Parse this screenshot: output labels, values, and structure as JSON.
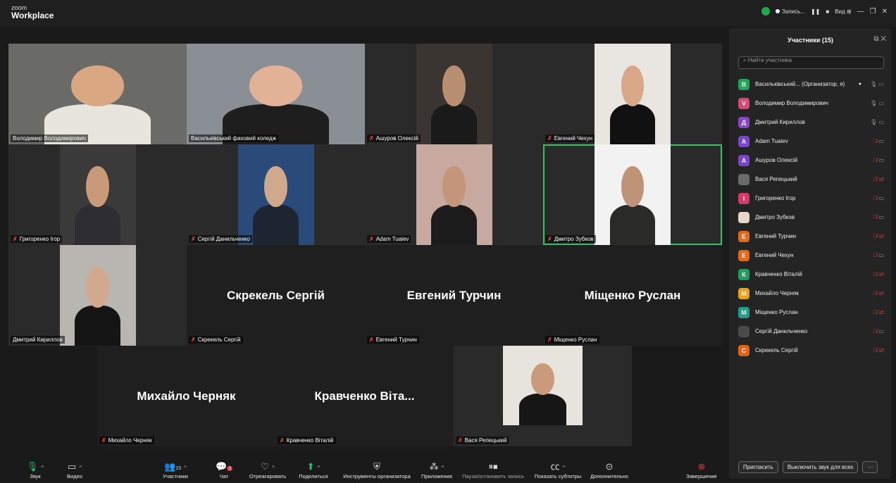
{
  "app": {
    "brand_small": "zoom",
    "brand": "Workplace"
  },
  "titlebar": {
    "recording": "Запись...",
    "view": "Вид"
  },
  "tiles": [
    {
      "name": "Володимир Володимирович",
      "muted": false,
      "video": true,
      "skin": "#d9a882",
      "shirt": "#e8e4de",
      "bg": "#6a6a66"
    },
    {
      "name": "Васильківський фаховий коледж",
      "muted": false,
      "video": true,
      "skin": "#e2b297",
      "shirt": "#1e1e1e",
      "bg": "#8a8f96"
    },
    {
      "name": "Ашуров Олексій",
      "muted": true,
      "video": true,
      "skin": "#b98f72",
      "shirt": "#1a1a1a",
      "bg": "#3a3530"
    },
    {
      "name": "Евгений Чехун",
      "muted": true,
      "video": true,
      "skin": "#d8a889",
      "shirt": "#111",
      "bg": "#e9e6e2"
    },
    {
      "name": "Григоренко Ігор",
      "muted": true,
      "video": true,
      "skin": "#c99a79",
      "shirt": "#2d2d33",
      "bg": "#3a3a3a"
    },
    {
      "name": "Сергій Данильченко",
      "muted": true,
      "video": true,
      "skin": "#d0a88c",
      "shirt": "#1d2530",
      "bg": "#2a4a7a"
    },
    {
      "name": "Adam Tuaiev",
      "muted": true,
      "video": true,
      "skin": "#c49578",
      "shirt": "#1c1c1c",
      "bg": "#c7a9a0"
    },
    {
      "name": "Дмитро Зубков",
      "muted": true,
      "video": true,
      "skin": "#bf9378",
      "shirt": "#2a2a28",
      "bg": "#f2f2f2",
      "active": true
    },
    {
      "name": "Дмитрий Кириллов",
      "muted": false,
      "video": true,
      "skin": "#d2a88e",
      "shirt": "#151515",
      "bg": "#b9b6b2"
    },
    {
      "name": "Скрекель Сергій",
      "muted": true,
      "video": false
    },
    {
      "name": "Евгений Турчин",
      "muted": true,
      "video": false
    },
    {
      "name": "Міщенко Руслан",
      "muted": true,
      "video": false
    },
    {
      "name": "Михайло Черняк",
      "muted": true,
      "video": false
    },
    {
      "name": "Кравченко Віталій",
      "muted": true,
      "video": false,
      "display": "Кравченко  Віта..."
    },
    {
      "name": "Вася Репецький",
      "muted": true,
      "video": true,
      "skin": "#c99a7c",
      "shirt": "#161616",
      "bg": "#e7e4de"
    }
  ],
  "toolbar": {
    "audio": "Звук",
    "video": "Видео",
    "participants": "Участники",
    "participants_count": "15",
    "chat": "Чат",
    "chat_badge": "3",
    "react": "Отреагировать",
    "share": "Поделиться",
    "host_tools": "Инструменты организатора",
    "apps": "Приложения",
    "pause_record": "Пауза/остановить запись",
    "captions": "Показать субтитры",
    "more": "Дополнительно",
    "end": "Завершение"
  },
  "panel": {
    "title": "Участники (15)",
    "search_placeholder": "Найти участника",
    "participants": [
      {
        "initial": "В",
        "color": "#22a35a",
        "name": "Васильківський... (Организатор, я)",
        "muted": false,
        "video_off": false,
        "rec": true
      },
      {
        "initial": "V",
        "color": "#d14a7a",
        "name": "Володимир Володимирович",
        "muted": false,
        "video_off": false
      },
      {
        "initial": "Д",
        "color": "#8a45c4",
        "name": "Дмитрий Кириллов",
        "muted": false,
        "video_off": false
      },
      {
        "initial": "A",
        "color": "#7a45c8",
        "name": "Adam Tuaiev",
        "muted": true,
        "video_off": false
      },
      {
        "initial": "A",
        "color": "#7a45c8",
        "name": "Ашуров Олексій",
        "muted": true,
        "video_off": false
      },
      {
        "initial": "",
        "color": "#6a6a6a",
        "name": "Вася Репецький",
        "muted": true,
        "video_off": true
      },
      {
        "initial": "І",
        "color": "#d23a6a",
        "name": "Григоренко Ігор",
        "muted": true,
        "video_off": false
      },
      {
        "initial": "",
        "color": "#e8d6c8",
        "name": "Дмитро Зубков",
        "muted": true,
        "video_off": false
      },
      {
        "initial": "Е",
        "color": "#e06a1a",
        "name": "Евгений Турчин",
        "muted": true,
        "video_off": true
      },
      {
        "initial": "Е",
        "color": "#e06a1a",
        "name": "Евгений Чехун",
        "muted": true,
        "video_off": false
      },
      {
        "initial": "К",
        "color": "#1f9e5f",
        "name": "Кравченко Віталій",
        "muted": true,
        "video_off": true
      },
      {
        "initial": "М",
        "color": "#e8a31e",
        "name": "Михайло Черняк",
        "muted": true,
        "video_off": true
      },
      {
        "initial": "М",
        "color": "#1f9e88",
        "name": "Міщенко Руслан",
        "muted": true,
        "video_off": true
      },
      {
        "initial": "",
        "color": "#4a4a4a",
        "name": "Сергій Данильченко",
        "muted": true,
        "video_off": false
      },
      {
        "initial": "С",
        "color": "#e0621a",
        "name": "Скрекель Сергій",
        "muted": true,
        "video_off": true
      }
    ],
    "invite": "Пригласить",
    "mute_all": "Выключить звук для всех",
    "more": "···"
  }
}
